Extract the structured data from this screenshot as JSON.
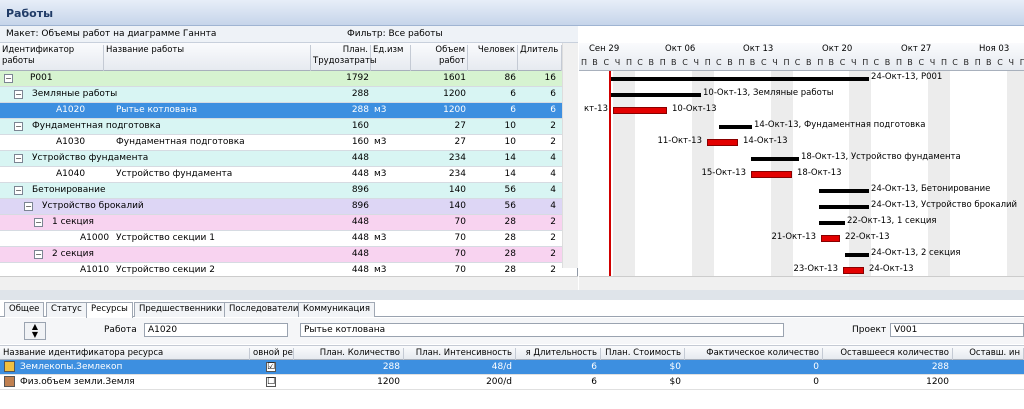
{
  "window": {
    "title": "Работы"
  },
  "toolbar": {
    "layout": "Макет: Объемы работ на диаграмме Ганнта",
    "filter": "Фильтр: Все работы"
  },
  "columns": {
    "id": "Идентификатор работы",
    "name": "Название работы",
    "planned_labor": "План. Трудозатраты",
    "unit": "Ед.изм",
    "volume": "Объем работ",
    "people": "Человек",
    "duration": "Длитель"
  },
  "rows": [
    {
      "id": "P001",
      "name": "",
      "labor": "1792",
      "unit": "",
      "vol": "1601",
      "ppl": "86",
      "dur": "16",
      "level": 0,
      "toggle": "−",
      "bg": "#d6f3d0"
    },
    {
      "id": "",
      "name": "Земляные работы",
      "labor": "288",
      "unit": "",
      "vol": "1200",
      "ppl": "6",
      "dur": "6",
      "level": 1,
      "toggle": "−",
      "bg": "#d8f5f3"
    },
    {
      "id": "A1020",
      "name": "Рытье котлована",
      "labor": "288",
      "unit": "м3",
      "vol": "1200",
      "ppl": "6",
      "dur": "6",
      "level": 2,
      "toggle": "",
      "bg": "#3d8fe0",
      "selected": true
    },
    {
      "id": "",
      "name": "Фундаментная подготовка",
      "labor": "160",
      "unit": "",
      "vol": "27",
      "ppl": "10",
      "dur": "2",
      "level": 1,
      "toggle": "−",
      "bg": "#d8f5f3"
    },
    {
      "id": "A1030",
      "name": "Фундаментная подготовка",
      "labor": "160",
      "unit": "м3",
      "vol": "27",
      "ppl": "10",
      "dur": "2",
      "level": 2,
      "toggle": "",
      "bg": "#ffffff"
    },
    {
      "id": "",
      "name": "Устройство фундамента",
      "labor": "448",
      "unit": "",
      "vol": "234",
      "ppl": "14",
      "dur": "4",
      "level": 1,
      "toggle": "−",
      "bg": "#d8f5f3"
    },
    {
      "id": "A1040",
      "name": "Устройство фундамента",
      "labor": "448",
      "unit": "м3",
      "vol": "234",
      "ppl": "14",
      "dur": "4",
      "level": 2,
      "toggle": "",
      "bg": "#ffffff"
    },
    {
      "id": "",
      "name": "Бетонирование",
      "labor": "896",
      "unit": "",
      "vol": "140",
      "ppl": "56",
      "dur": "4",
      "level": 1,
      "toggle": "−",
      "bg": "#d8f5f3"
    },
    {
      "id": "",
      "name": "Устройство брокалий",
      "labor": "896",
      "unit": "",
      "vol": "140",
      "ppl": "56",
      "dur": "4",
      "level": 2,
      "toggle": "−",
      "bg": "#ddd6f5"
    },
    {
      "id": "",
      "name": "1 секция",
      "labor": "448",
      "unit": "",
      "vol": "70",
      "ppl": "28",
      "dur": "2",
      "level": 3,
      "toggle": "−",
      "bg": "#f8d3f0"
    },
    {
      "id": "A1000",
      "name": "Устройство секции 1",
      "labor": "448",
      "unit": "м3",
      "vol": "70",
      "ppl": "28",
      "dur": "2",
      "level": 4,
      "toggle": "",
      "bg": "#ffffff"
    },
    {
      "id": "",
      "name": "2 секция",
      "labor": "448",
      "unit": "",
      "vol": "70",
      "ppl": "28",
      "dur": "2",
      "level": 3,
      "toggle": "−",
      "bg": "#f8d3f0"
    },
    {
      "id": "A1010",
      "name": "Устройство секции 2",
      "labor": "448",
      "unit": "м3",
      "vol": "70",
      "ppl": "28",
      "dur": "2",
      "level": 4,
      "toggle": "",
      "bg": "#ffffff"
    }
  ],
  "gantt": {
    "weeks": [
      "Сен 29",
      "Окт 06",
      "Окт 13",
      "Окт 20",
      "Окт 27",
      "Ноя 03"
    ],
    "day_letters": [
      "П",
      "В",
      "С",
      "Ч",
      "П",
      "С",
      "В"
    ],
    "bars": [
      {
        "type": "summary",
        "label": "24-Окт-13, P001",
        "start_label": ""
      },
      {
        "type": "summary",
        "label": "10-Окт-13, Земляные работы",
        "start_label": ""
      },
      {
        "type": "task",
        "label": "10-Окт-13",
        "start_label": "кт-13"
      },
      {
        "type": "summary",
        "label": "14-Окт-13, Фундаментная подготовка",
        "start_label": ""
      },
      {
        "type": "task",
        "label": "14-Окт-13",
        "start_label": "11-Окт-13"
      },
      {
        "type": "summary",
        "label": "18-Окт-13, Устройство фундамента",
        "start_label": ""
      },
      {
        "type": "task",
        "label": "18-Окт-13",
        "start_label": "15-Окт-13"
      },
      {
        "type": "summary",
        "label": "24-Окт-13, Бетонирование",
        "start_label": ""
      },
      {
        "type": "summary",
        "label": "24-Окт-13, Устройство брокалий",
        "start_label": ""
      },
      {
        "type": "summary",
        "label": "22-Окт-13, 1 секция",
        "start_label": ""
      },
      {
        "type": "task",
        "label": "22-Окт-13",
        "start_label": "21-Окт-13"
      },
      {
        "type": "summary",
        "label": "24-Окт-13, 2 секция",
        "start_label": ""
      },
      {
        "type": "task",
        "label": "24-Окт-13",
        "start_label": "23-Окт-13"
      }
    ]
  },
  "tabs": [
    "Общее",
    "Статус",
    "Ресурсы",
    "Предшественники",
    "Последователи",
    "Коммуникация"
  ],
  "active_tab": "Ресурсы",
  "form": {
    "work_label": "Работа",
    "work_id": "A1020",
    "work_name": "Рытье котлована",
    "project_label": "Проект",
    "project_id": "V001"
  },
  "resources": {
    "headers": [
      "Название идентификатора ресурса",
      "овной рес",
      "План. Количество",
      "План. Интенсивность",
      "я Длительность",
      "План. Стоимость",
      "Фактическое количество",
      "Оставшееся количество",
      "Оставш. ин"
    ],
    "rows": [
      {
        "name": "Землекопы.Землекоп",
        "primary": "☑",
        "qty": "288",
        "intensity": "48/d",
        "dur": "6",
        "cost": "$0",
        "actual": "0",
        "remaining": "288",
        "selected": true
      },
      {
        "name": "Физ.объем земли.Земля",
        "primary": "☐",
        "qty": "1200",
        "intensity": "200/d",
        "dur": "6",
        "cost": "$0",
        "actual": "0",
        "remaining": "1200",
        "selected": false
      }
    ]
  }
}
